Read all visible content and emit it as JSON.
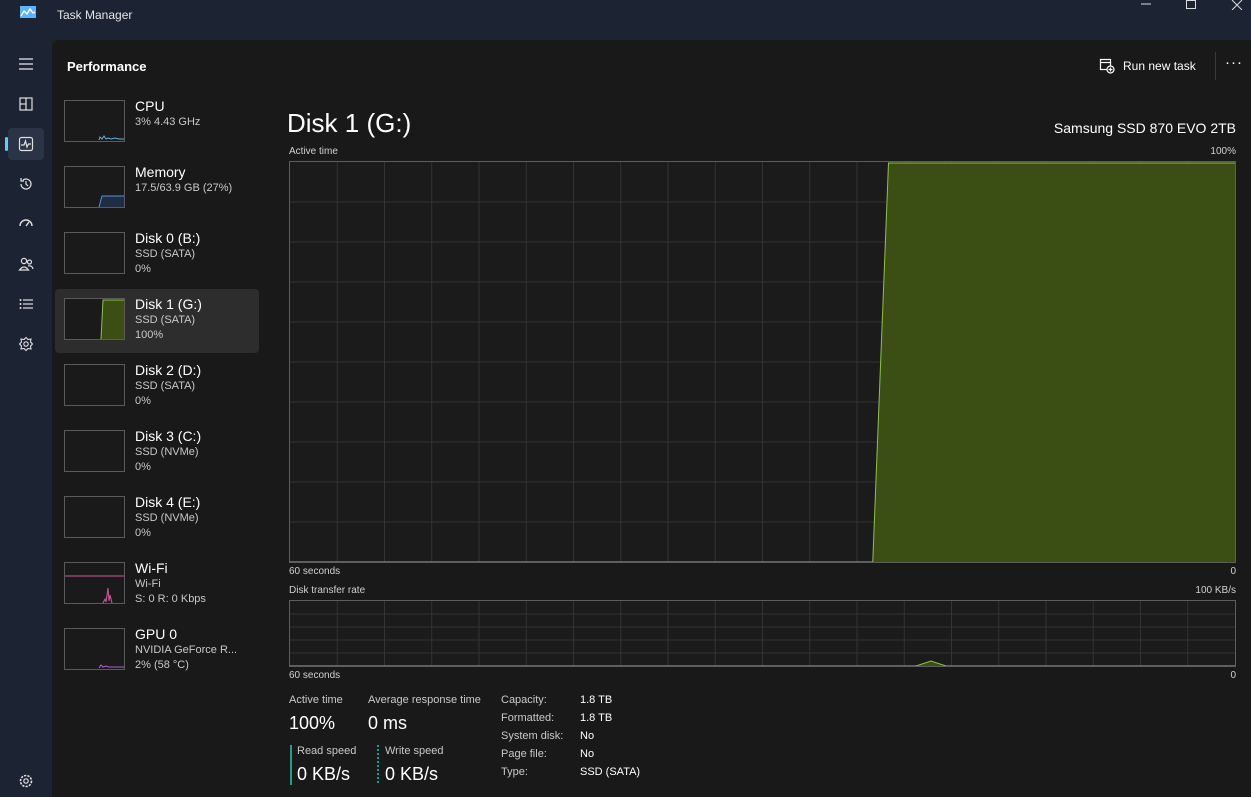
{
  "window": {
    "title": "Task Manager",
    "controls": [
      "minimize",
      "maximize",
      "close"
    ]
  },
  "nav": {
    "items": [
      {
        "icon": "hamburger-icon"
      },
      {
        "icon": "processes-icon"
      },
      {
        "icon": "performance-icon",
        "active": true
      },
      {
        "icon": "app-history-icon"
      },
      {
        "icon": "startup-apps-icon"
      },
      {
        "icon": "users-icon"
      },
      {
        "icon": "details-icon"
      },
      {
        "icon": "services-icon"
      }
    ],
    "settings_icon": "gear-icon"
  },
  "header": {
    "title": "Performance",
    "run_task_label": "Run new task",
    "more_label": "···"
  },
  "devices": [
    {
      "name": "CPU",
      "line1": "3% 4.43 GHz",
      "line2": "",
      "color": "#5db2e6"
    },
    {
      "name": "Memory",
      "line1": "17.5/63.9 GB (27%)",
      "line2": "",
      "color": "#5a8fe0"
    },
    {
      "name": "Disk 0 (B:)",
      "line1": "SSD (SATA)",
      "line2": "0%",
      "color": "#8fc33f"
    },
    {
      "name": "Disk 1 (G:)",
      "line1": "SSD (SATA)",
      "line2": "100%",
      "color": "#8fc33f",
      "selected": true
    },
    {
      "name": "Disk 2 (D:)",
      "line1": "SSD (SATA)",
      "line2": "0%",
      "color": "#8fc33f"
    },
    {
      "name": "Disk 3 (C:)",
      "line1": "SSD (NVMe)",
      "line2": "0%",
      "color": "#8fc33f"
    },
    {
      "name": "Disk 4 (E:)",
      "line1": "SSD (NVMe)",
      "line2": "0%",
      "color": "#8fc33f"
    },
    {
      "name": "Wi-Fi",
      "line1": "Wi-Fi",
      "line2": "S: 0 R: 0 Kbps",
      "color": "#d0589a"
    },
    {
      "name": "GPU 0",
      "line1": "NVIDIA GeForce R...",
      "line2": "2% (58 °C)",
      "color": "#b15fd1"
    }
  ],
  "detail": {
    "title": "Disk 1 (G:)",
    "model": "Samsung SSD 870 EVO 2TB",
    "active_graph": {
      "label": "Active time",
      "max_label": "100%",
      "time_label": "60 seconds",
      "zero_label": "0"
    },
    "transfer_graph": {
      "label": "Disk transfer rate",
      "max_label": "100 KB/s",
      "time_label": "60 seconds",
      "zero_label": "0"
    },
    "stats": {
      "active_time_label": "Active time",
      "active_time_value": "100%",
      "response_label": "Average response time",
      "response_value": "0 ms",
      "read_label": "Read speed",
      "read_value": "0 KB/s",
      "write_label": "Write speed",
      "write_value": "0 KB/s"
    },
    "properties": [
      {
        "key": "Capacity:",
        "value": "1.8 TB"
      },
      {
        "key": "Formatted:",
        "value": "1.8 TB"
      },
      {
        "key": "System disk:",
        "value": "No"
      },
      {
        "key": "Page file:",
        "value": "No"
      },
      {
        "key": "Type:",
        "value": "SSD (SATA)"
      }
    ],
    "colors": {
      "line": "#8fc33f",
      "fill": "#3b4f14",
      "read_speed": "#1f9e94",
      "write_speed": "#1f9e94"
    }
  },
  "chart_data": [
    {
      "type": "area",
      "title": "Active time",
      "x": [
        60,
        59,
        58,
        57,
        56,
        55,
        54,
        53,
        52,
        51,
        50,
        49,
        48,
        47,
        46,
        45,
        44,
        43,
        42,
        41,
        40,
        39,
        38,
        37,
        36,
        35,
        34,
        33,
        32,
        31,
        30,
        29,
        28,
        27,
        26,
        25,
        24,
        23,
        22,
        21,
        20,
        19,
        18,
        17,
        16,
        15,
        14,
        13,
        12,
        11,
        10,
        9,
        8,
        7,
        6,
        5,
        4,
        3,
        2,
        1,
        0
      ],
      "series": [
        {
          "values": [
            0,
            0,
            0,
            0,
            0,
            0,
            0,
            0,
            0,
            0,
            0,
            0,
            0,
            0,
            0,
            0,
            0,
            0,
            0,
            0,
            0,
            0,
            0,
            0,
            0,
            0,
            0,
            0,
            0,
            0,
            0,
            0,
            0,
            0,
            0,
            0,
            0,
            0,
            100,
            100,
            100,
            100,
            100,
            100,
            100,
            100,
            100,
            100,
            100,
            100,
            100,
            100,
            100,
            100,
            100,
            100,
            100,
            100,
            100,
            100,
            100
          ]
        }
      ],
      "ylim": [
        0,
        100
      ],
      "xlim": [
        60,
        0
      ]
    },
    {
      "type": "area",
      "title": "Disk transfer rate",
      "x": [
        60,
        59,
        58,
        57,
        56,
        55,
        54,
        53,
        52,
        51,
        50,
        49,
        48,
        47,
        46,
        45,
        44,
        43,
        42,
        41,
        40,
        39,
        38,
        37,
        36,
        35,
        34,
        33,
        32,
        31,
        30,
        29,
        28,
        27,
        26,
        25,
        24,
        23,
        22,
        21,
        20,
        19,
        18,
        17,
        16,
        15,
        14,
        13,
        12,
        11,
        10,
        9,
        8,
        7,
        6,
        5,
        4,
        3,
        2,
        1,
        0
      ],
      "series": [
        {
          "values": [
            0,
            0,
            0,
            0,
            0,
            0,
            0,
            0,
            0,
            0,
            0,
            0,
            0,
            0,
            0,
            0,
            0,
            0,
            0,
            0,
            0,
            0,
            0,
            0,
            0,
            0,
            0,
            0,
            0,
            0,
            0,
            0,
            0,
            0,
            0,
            0,
            0,
            0,
            0,
            0,
            0,
            0,
            0,
            0,
            0,
            0,
            0,
            0,
            0,
            0,
            0,
            0,
            0,
            0,
            0,
            0,
            0,
            0,
            0,
            0,
            0
          ]
        }
      ],
      "ylim": [
        0,
        100
      ],
      "xlim": [
        60,
        0
      ]
    }
  ]
}
